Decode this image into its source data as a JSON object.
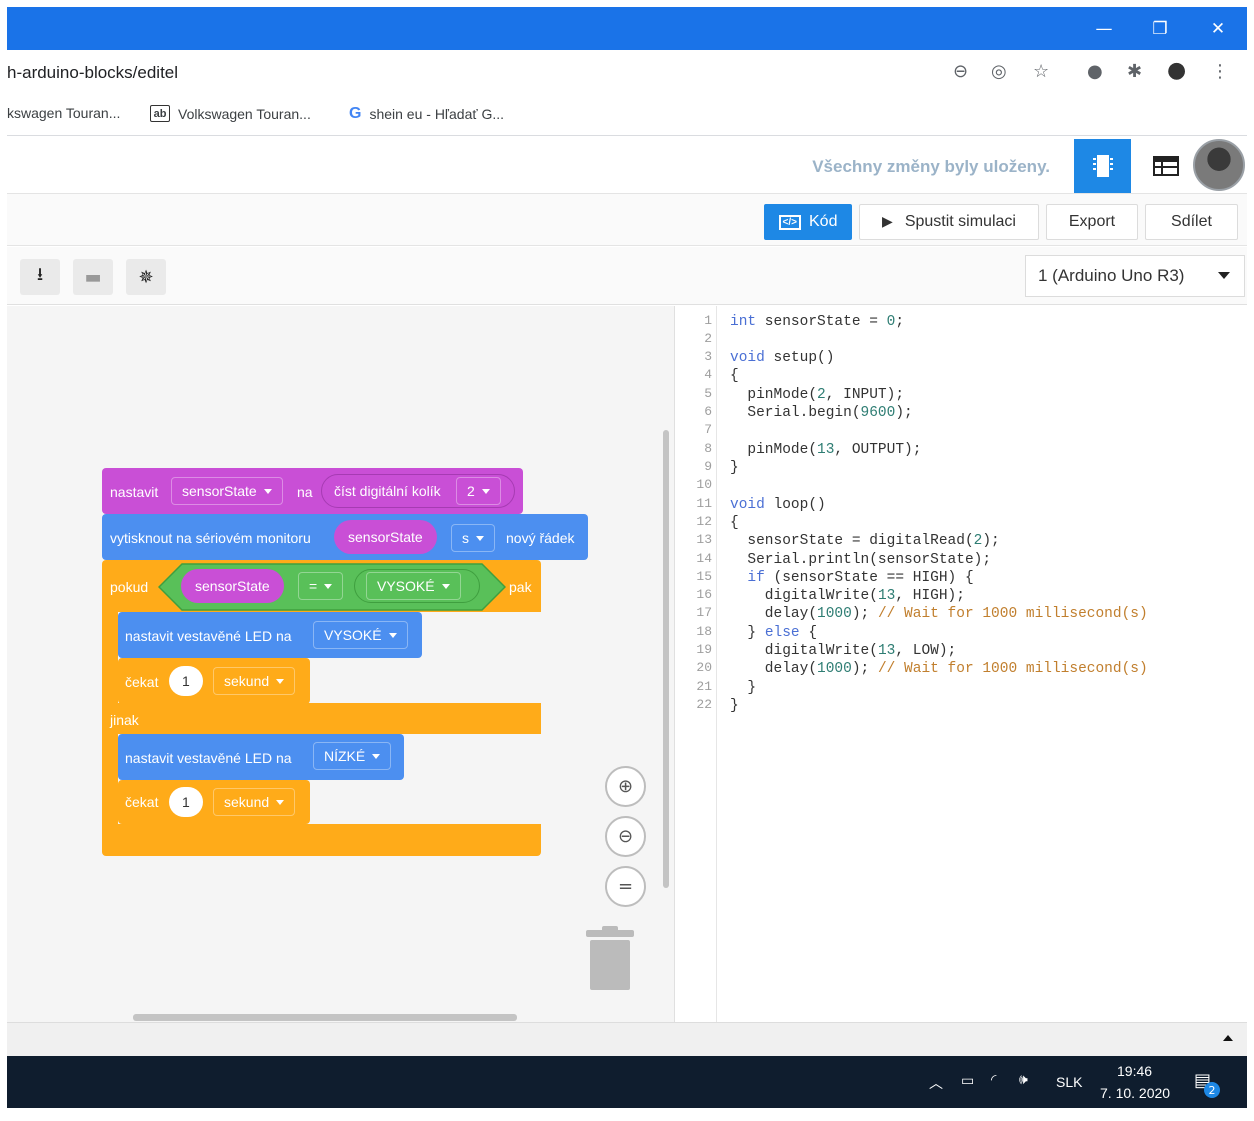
{
  "window": {
    "minimize": "—",
    "restore": "❐",
    "close": "✕"
  },
  "address_bar": {
    "url": "h-arduino-blocks/editel"
  },
  "bookmarks": [
    {
      "label": "kswagen Touran..."
    },
    {
      "icon": "ab",
      "label": "Volkswagen Touran..."
    },
    {
      "icon": "G",
      "label": "shein eu - Hľadať G..."
    }
  ],
  "app": {
    "saved_status": "Všechny změny byly uloženy."
  },
  "toolbar": {
    "code_label": "Kód",
    "code_icon": "</>",
    "simulate_label": "Spustit simulaci",
    "export_label": "Export",
    "share_label": "Sdílet"
  },
  "board": {
    "selected": "1 (Arduino Uno R3)"
  },
  "blocks": {
    "set_label": "nastavit",
    "set_var": "sensorState",
    "to_label": "na",
    "read_label": "číst digitální kolík",
    "read_pin": "2",
    "print_label": "vytisknout na sériovém monitoru",
    "print_var": "sensorState",
    "print_opt": "s",
    "newline_label": "nový řádek",
    "if_label": "pokud",
    "cmp_var": "sensorState",
    "cmp_op": "=",
    "cmp_val": "VYSOKÉ",
    "then_label": "pak",
    "led1_label": "nastavit vestavěné LED na",
    "led1_val": "VYSOKÉ",
    "wait1_label": "čekat",
    "wait1_num": "1",
    "wait1_unit": "sekund",
    "else_label": "jinak",
    "led2_label": "nastavit vestavěné LED na",
    "led2_val": "NÍZKÉ",
    "wait2_label": "čekat",
    "wait2_num": "1",
    "wait2_unit": "sekund"
  },
  "code": {
    "line_numbers": [
      "1",
      "2",
      "3",
      "4",
      "5",
      "6",
      "7",
      "8",
      "9",
      "10",
      "11",
      "12",
      "13",
      "14",
      "15",
      "16",
      "17",
      "18",
      "19",
      "20",
      "21",
      "22"
    ]
  },
  "taskbar": {
    "language": "SLK",
    "time": "19:46",
    "date": "7. 10. 2020",
    "notifications": "2"
  },
  "colors": {
    "chrome_blue": "#1a73e8",
    "accent": "#1e88e5",
    "block_purple": "#c94fd6",
    "block_blue": "#4c8ff0",
    "block_orange": "#ffab19",
    "block_green": "#59c059",
    "taskbar": "#0f1d2e"
  }
}
